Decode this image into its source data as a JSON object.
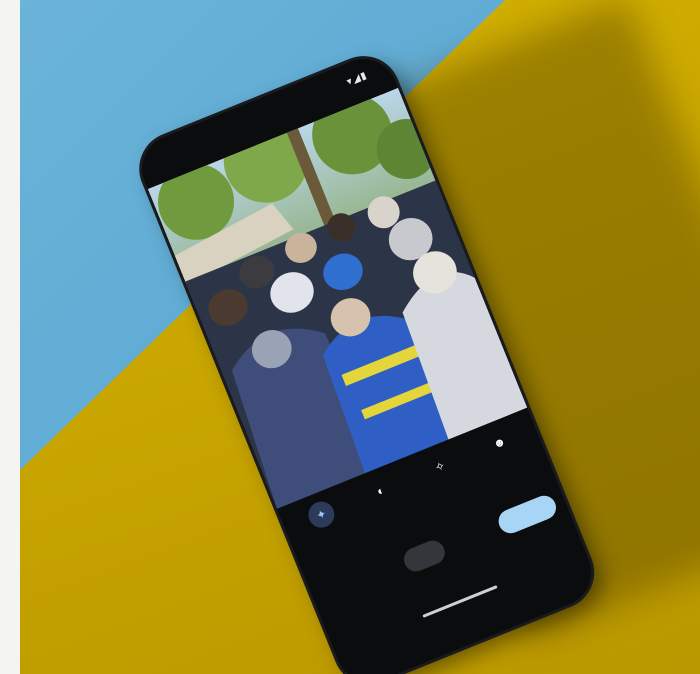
{
  "status_bar": {
    "time": "",
    "icons": "▾◢▮"
  },
  "photo_editor": {
    "tools": [
      {
        "label": "",
        "icon": "magic-editor-icon",
        "glyph": "✦",
        "active": true
      },
      {
        "label": "",
        "icon": "unblur-icon",
        "glyph": "◐",
        "active": false
      },
      {
        "label": "",
        "icon": "magic-eraser-icon",
        "glyph": "✧",
        "active": false
      },
      {
        "label": "",
        "icon": "portrait-icon",
        "glyph": "☻",
        "active": false
      }
    ],
    "chips": [
      {
        "label": "",
        "selected": false
      },
      {
        "label": "",
        "selected": false
      },
      {
        "label": "",
        "selected": true
      },
      {
        "label": "",
        "selected": false
      },
      {
        "label": "",
        "primary": true
      }
    ],
    "cancel_label": ""
  },
  "colors": {
    "backdrop_blue": "#5aa8d3",
    "backdrop_yellow": "#c9a600",
    "phone_body": "#0b0c0e",
    "accent": "#a8d4f5"
  }
}
